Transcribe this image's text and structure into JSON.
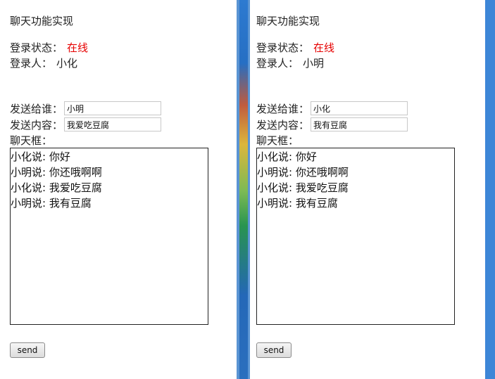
{
  "left": {
    "title": "聊天功能实现",
    "status_label": "登录状态：",
    "status_value": "在线",
    "user_label": "登录人：",
    "user_value": "小化",
    "to_label": "发送给谁：",
    "to_value": "小明",
    "msg_label": "发送内容：",
    "msg_value": "我爱吃豆腐",
    "chat_label": "聊天框：",
    "messages": [
      "小化说: 你好",
      "小明说: 你还哦啊啊",
      "小化说: 我爱吃豆腐",
      "小明说: 我有豆腐"
    ],
    "send_label": "send"
  },
  "right": {
    "title": "聊天功能实现",
    "status_label": "登录状态：",
    "status_value": "在线",
    "user_label": "登录人：",
    "user_value": "小明",
    "to_label": "发送给谁：",
    "to_value": "小化",
    "msg_label": "发送内容：",
    "msg_value": "我有豆腐",
    "chat_label": "聊天框：",
    "messages": [
      "小化说: 你好",
      "小明说: 你还哦啊啊",
      "小化说: 我爱吃豆腐",
      "小明说: 我有豆腐"
    ],
    "send_label": "send"
  },
  "colors": {
    "online": "#e60000",
    "desktop": "#2b6fbe",
    "window_border": "#5a94d3"
  }
}
